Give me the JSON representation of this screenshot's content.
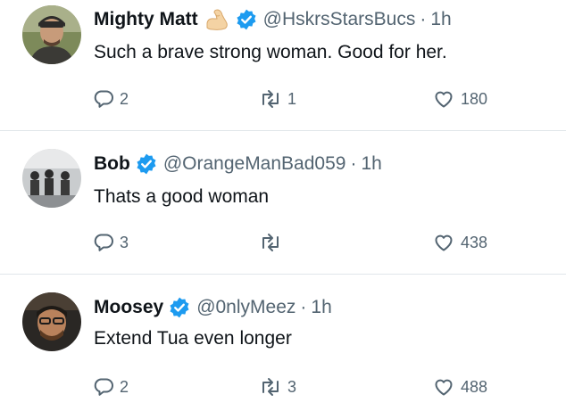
{
  "tweets": [
    {
      "name": "Mighty Matt",
      "emoji_icon": "flexed-biceps-icon",
      "verified_icon": "verified-badge-icon",
      "handle": "@HskrsStarsBucs",
      "separator": "·",
      "time": "1h",
      "text": "Such a brave strong woman. Good for her.",
      "replies": "2",
      "retweets": "1",
      "likes": "180"
    },
    {
      "name": "Bob",
      "verified_icon": "verified-badge-icon",
      "handle": "@OrangeManBad059",
      "separator": "·",
      "time": "1h",
      "text": "Thats a good woman",
      "replies": "3",
      "retweets": "",
      "likes": "438"
    },
    {
      "name": "Moosey",
      "verified_icon": "verified-badge-icon",
      "handle": "@0nlyMeez",
      "separator": "·",
      "time": "1h",
      "text": "Extend Tua even longer",
      "replies": "2",
      "retweets": "3",
      "likes": "488"
    }
  ],
  "colors": {
    "verified": "#1d9bf0",
    "secondary_text": "#536471",
    "primary_text": "#0f1419",
    "divider": "#e1e6ea"
  }
}
